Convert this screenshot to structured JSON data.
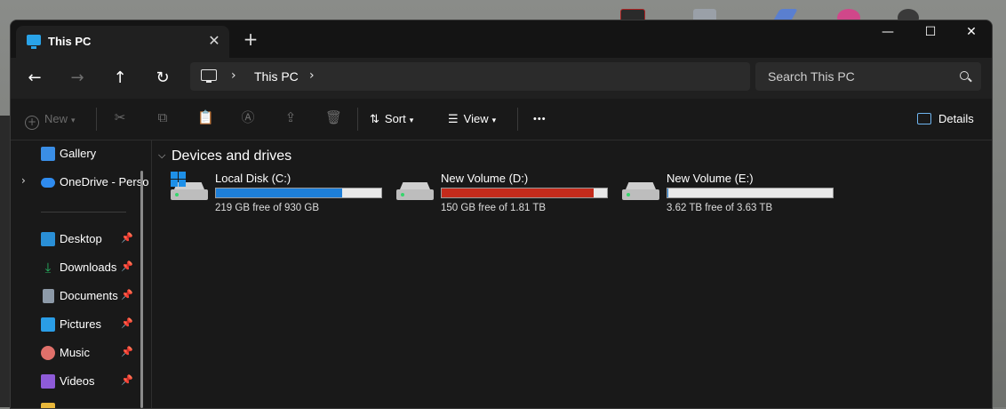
{
  "window": {
    "tab_title": "This PC",
    "tab_close_glyph": "✕",
    "new_tab_glyph": "+",
    "controls": {
      "minimize": "—",
      "maximize": "☐",
      "close": "✕"
    }
  },
  "nav": {
    "back_glyph": "←",
    "forward_glyph": "→",
    "up_glyph": "↑",
    "refresh_glyph": "↻",
    "address_path": "This PC",
    "search_placeholder": "Search This PC"
  },
  "toolbar": {
    "new_label": "New",
    "sort_label": "Sort",
    "view_label": "View",
    "more_glyph": "•••",
    "details_label": "Details",
    "icons": [
      "cut-icon",
      "copy-icon",
      "paste-icon",
      "rename-icon",
      "share-icon",
      "delete-icon"
    ]
  },
  "sidebar": {
    "top_items": [
      {
        "label": "Gallery",
        "icon": "gallery-icon",
        "color": "#3a8ee6"
      },
      {
        "label": "OneDrive - Perso",
        "icon": "onedrive-icon",
        "color": "#2f8cf0"
      }
    ],
    "pinned_items": [
      {
        "label": "Desktop",
        "icon": "desktop-icon",
        "color": "#2a8fd6"
      },
      {
        "label": "Downloads",
        "icon": "downloads-icon",
        "color": "#27b563"
      },
      {
        "label": "Documents",
        "icon": "documents-icon",
        "color": "#8d9aa8"
      },
      {
        "label": "Pictures",
        "icon": "pictures-icon",
        "color": "#2a9de6"
      },
      {
        "label": "Music",
        "icon": "music-icon",
        "color": "#e0706a"
      },
      {
        "label": "Videos",
        "icon": "videos-icon",
        "color": "#8e5bd8"
      }
    ],
    "pin_glyph": "📌"
  },
  "main": {
    "section_title": "Devices and drives",
    "drives": [
      {
        "name": "Local Disk (C:)",
        "free_text": "219 GB free of 930 GB",
        "used_fraction": 0.765,
        "bar_color": "#1e7fd8",
        "system": true
      },
      {
        "name": "New Volume (D:)",
        "free_text": "150 GB free of 1.81 TB",
        "used_fraction": 0.92,
        "bar_color": "#c42b1c",
        "system": false
      },
      {
        "name": "New Volume (E:)",
        "free_text": "3.62 TB free of 3.63 TB",
        "used_fraction": 0.003,
        "bar_color": "#1e7fd8",
        "system": false
      }
    ]
  }
}
